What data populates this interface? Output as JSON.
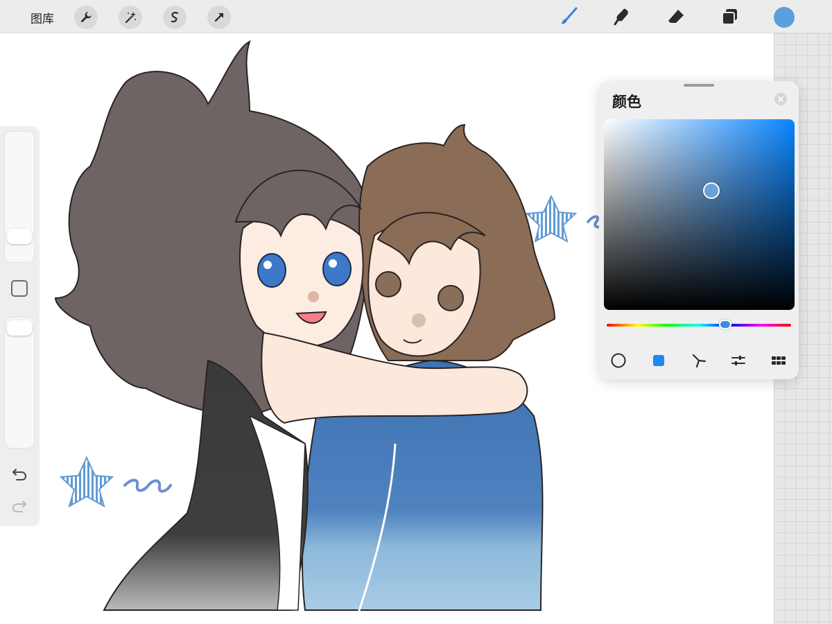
{
  "topbar": {
    "gallery_label": "图库",
    "tools": [
      "wrench-icon",
      "magic-wand-icon",
      "selection-icon",
      "arrow-icon"
    ],
    "right_tools": [
      "brush-icon",
      "smudge-icon",
      "eraser-icon",
      "layers-icon"
    ],
    "active_tool": "brush-icon",
    "current_color": "#5b9fdc"
  },
  "sidebar": {
    "controls": [
      "brush-size-slider",
      "modify-button",
      "opacity-slider",
      "undo-icon",
      "redo-icon"
    ]
  },
  "color_panel": {
    "title": "颜色",
    "selected_hue": "#0a85ff",
    "selected_color": "#6aa2d8",
    "modes": [
      "disc-mode-icon",
      "classic-mode-icon",
      "harmony-mode-icon",
      "value-mode-icon",
      "palettes-mode-icon"
    ],
    "active_mode": "classic-mode-icon"
  },
  "canvas": {
    "content": "illustration"
  }
}
